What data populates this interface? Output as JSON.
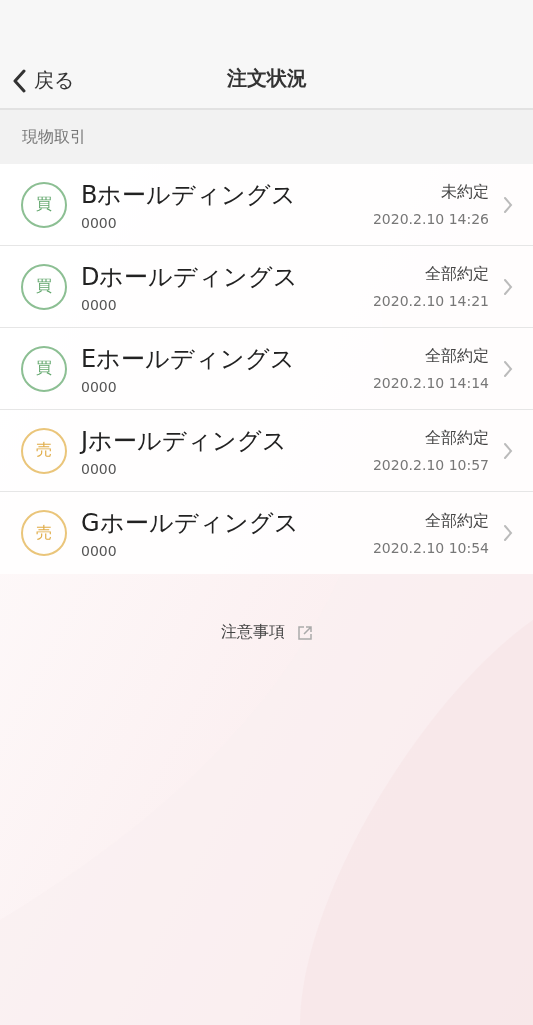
{
  "nav": {
    "back": "戻る",
    "title": "注文状況"
  },
  "section": "現物取引",
  "orders": [
    {
      "kind": "buy",
      "badge": "買",
      "name": "Bホールディングス",
      "code": "0000",
      "status": "未約定",
      "time": "2020.2.10 14:26"
    },
    {
      "kind": "buy",
      "badge": "買",
      "name": "Dホールディングス",
      "code": "0000",
      "status": "全部約定",
      "time": "2020.2.10 14:21"
    },
    {
      "kind": "buy",
      "badge": "買",
      "name": "Eホールディングス",
      "code": "0000",
      "status": "全部約定",
      "time": "2020.2.10 14:14"
    },
    {
      "kind": "sell",
      "badge": "売",
      "name": "Jホールディングス",
      "code": "0000",
      "status": "全部約定",
      "time": "2020.2.10 10:57"
    },
    {
      "kind": "sell",
      "badge": "売",
      "name": "Gホールディングス",
      "code": "0000",
      "status": "全部約定",
      "time": "2020.2.10 10:54"
    }
  ],
  "footer_link": "注意事項"
}
